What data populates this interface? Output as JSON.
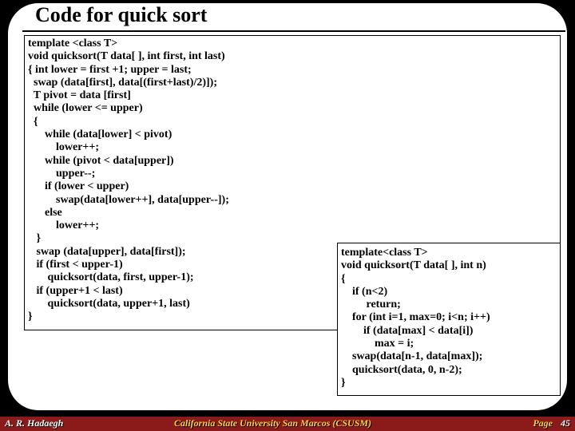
{
  "title": "Code for quick sort",
  "code_main": "template <class T>\nvoid quicksort(T data[ ], int first, int last)\n{ int lower = first +1; upper = last;\n  swap (data[first], data[(first+last)/2)]);\n  T pivot = data [first]\n  while (lower <= upper)\n  {\n      while (data[lower] < pivot)\n          lower++;\n      while (pivot < data[upper])\n          upper--;\n      if (lower < upper)\n          swap(data[lower++], data[upper--]);\n      else\n          lower++;\n   }\n   swap (data[upper], data[first]);\n   if (first < upper-1)\n       quicksort(data, first, upper-1);\n   if (upper+1 < last)\n       quicksort(data, upper+1, last)\n}",
  "code_side": "template<class T>\nvoid quicksort(T data[ ], int n)\n{\n    if (n<2)\n         return;\n    for (int i=1, max=0; i<n; i++)\n        if (data[max] < data[i])\n            max = i;\n    swap(data[n-1, data[max]);\n    quicksort(data, 0, n-2);\n}",
  "footer": {
    "author": "A. R. Hadaegh",
    "university": "California State University San Marcos (CSUSM)",
    "page_label": "Page",
    "page_num": "45"
  }
}
